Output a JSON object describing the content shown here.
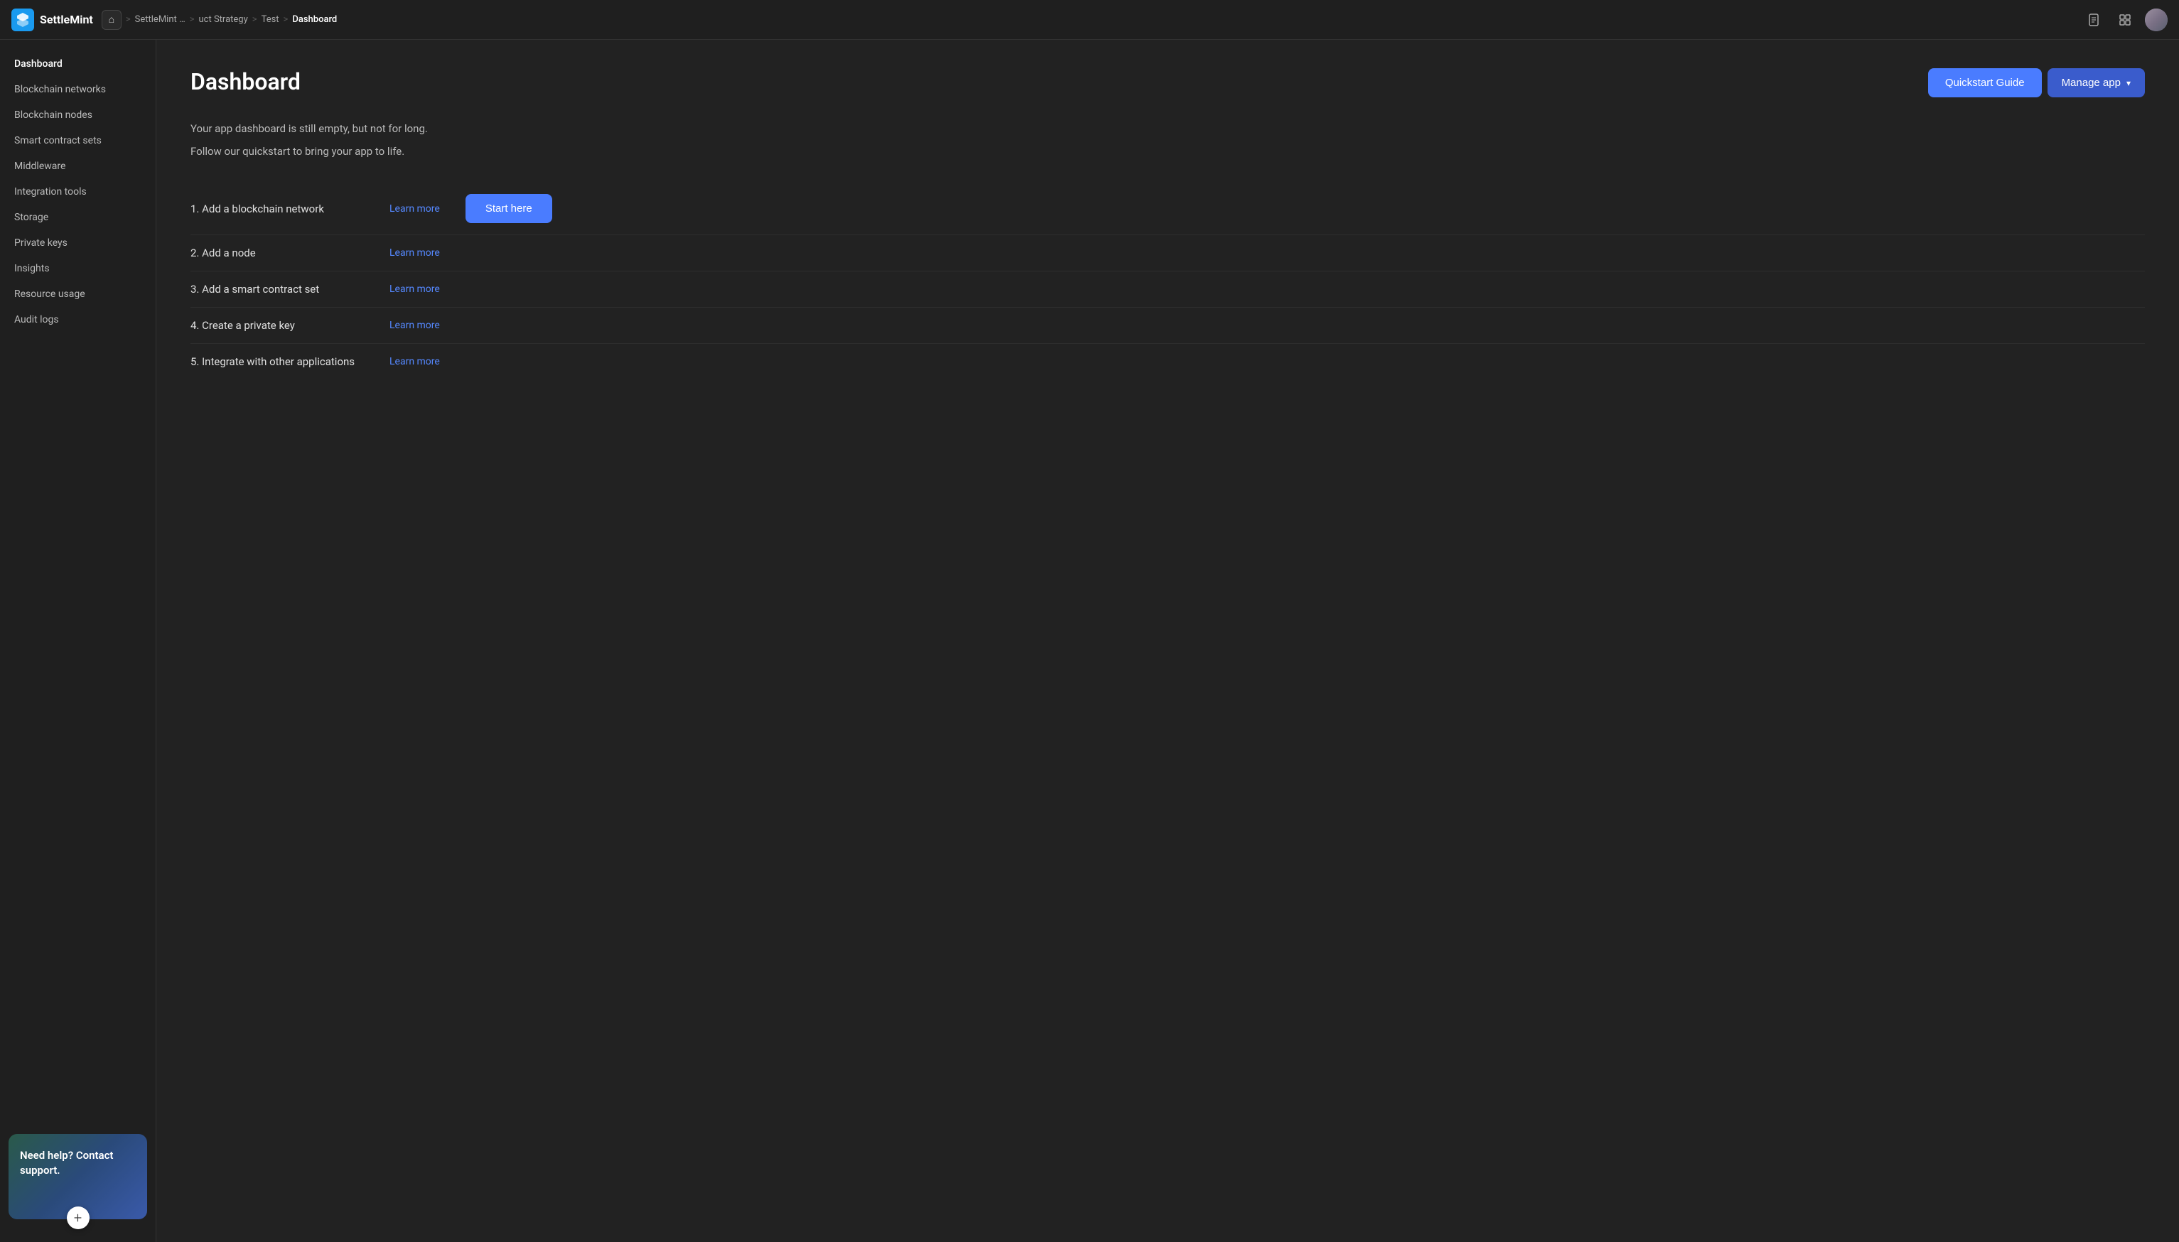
{
  "app": {
    "name": "SettleMint"
  },
  "topbar": {
    "breadcrumb": {
      "home_icon": "⌂",
      "segments": [
        "SettleMint …",
        "uct Strategy",
        "Test",
        "Dashboard"
      ],
      "separators": [
        ">",
        ">",
        ">"
      ]
    },
    "icons": {
      "document_icon": "document",
      "grid_icon": "grid"
    }
  },
  "sidebar": {
    "items": [
      {
        "id": "dashboard",
        "label": "Dashboard",
        "active": true
      },
      {
        "id": "blockchain-networks",
        "label": "Blockchain networks",
        "active": false
      },
      {
        "id": "blockchain-nodes",
        "label": "Blockchain nodes",
        "active": false
      },
      {
        "id": "smart-contract-sets",
        "label": "Smart contract sets",
        "active": false
      },
      {
        "id": "middleware",
        "label": "Middleware",
        "active": false
      },
      {
        "id": "integration-tools",
        "label": "Integration tools",
        "active": false
      },
      {
        "id": "storage",
        "label": "Storage",
        "active": false
      },
      {
        "id": "private-keys",
        "label": "Private keys",
        "active": false
      },
      {
        "id": "insights",
        "label": "Insights",
        "active": false
      },
      {
        "id": "resource-usage",
        "label": "Resource usage",
        "active": false
      },
      {
        "id": "audit-logs",
        "label": "Audit logs",
        "active": false
      }
    ],
    "help": {
      "text": "Need help? Contact support.",
      "btn_label": "+"
    }
  },
  "main": {
    "title": "Dashboard",
    "buttons": {
      "quickstart": "Quickstart Guide",
      "manage": "Manage app",
      "manage_chevron": "▾"
    },
    "intro": {
      "line1": "Your app dashboard is still empty, but not for long.",
      "line2": "Follow our quickstart to bring your app to life."
    },
    "steps": [
      {
        "id": "step-1",
        "label": "1. Add a blockchain network",
        "link_text": "Learn more",
        "has_start": true
      },
      {
        "id": "step-2",
        "label": "2. Add a node",
        "link_text": "Learn more",
        "has_start": false
      },
      {
        "id": "step-3",
        "label": "3. Add a smart contract set",
        "link_text": "Learn more",
        "has_start": false
      },
      {
        "id": "step-4",
        "label": "4. Create a private key",
        "link_text": "Learn more",
        "has_start": false
      },
      {
        "id": "step-5",
        "label": "5. Integrate with other applications",
        "link_text": "Learn more",
        "has_start": false
      }
    ],
    "start_btn": "Start here"
  }
}
